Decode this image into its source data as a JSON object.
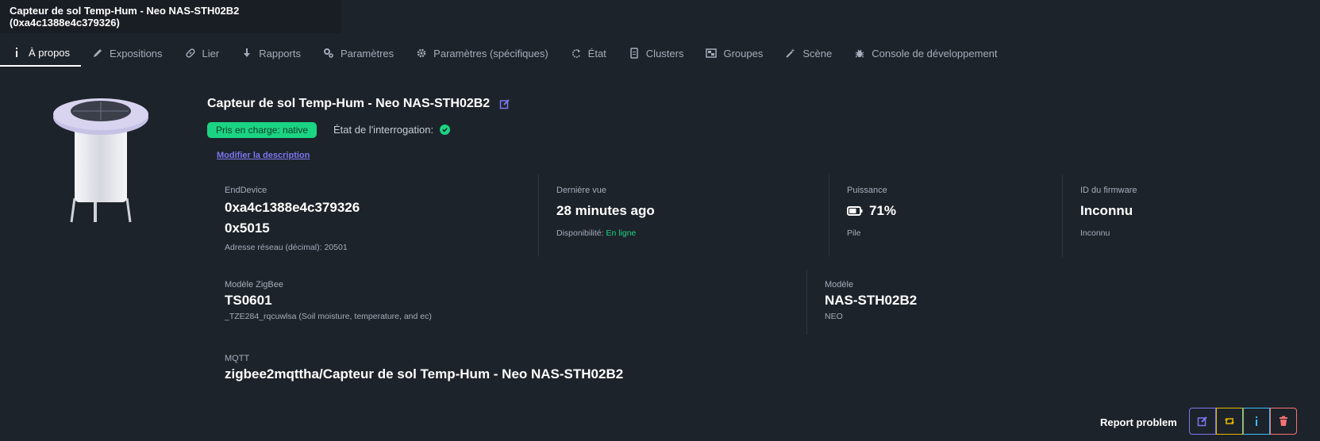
{
  "window_title": "Capteur de sol Temp-Hum - Neo NAS-STH02B2 (0xa4c1388e4c379326)",
  "tabs": [
    {
      "label": "À propos",
      "icon": "info-icon"
    },
    {
      "label": "Expositions",
      "icon": "pencil-icon"
    },
    {
      "label": "Lier",
      "icon": "link-icon"
    },
    {
      "label": "Rapports",
      "icon": "download-icon"
    },
    {
      "label": "Paramètres",
      "icon": "cogs-icon"
    },
    {
      "label": "Paramètres (spécifiques)",
      "icon": "gear-icon"
    },
    {
      "label": "État",
      "icon": "refresh-icon"
    },
    {
      "label": "Clusters",
      "icon": "file-icon"
    },
    {
      "label": "Groupes",
      "icon": "object-group-icon"
    },
    {
      "label": "Scène",
      "icon": "magic-wand-icon"
    },
    {
      "label": "Console de développement",
      "icon": "bug-icon"
    }
  ],
  "device": {
    "title": "Capteur de sol Temp-Hum - Neo NAS-STH02B2",
    "support_badge": "Pris en charge: native",
    "interrogation_label": "État de l'interrogation:",
    "edit_description": "Modifier la description"
  },
  "stats": {
    "enddevice": {
      "label": "EndDevice",
      "ieee": "0xa4c1388e4c379326",
      "nwk": "0x5015",
      "sub": "Adresse réseau (décimal): 20501"
    },
    "last_seen": {
      "label": "Dernière vue",
      "value": "28 minutes ago",
      "availability_label": "Disponibilité:",
      "availability_value": "En ligne"
    },
    "power": {
      "label": "Puissance",
      "value": "71%",
      "sub": "Pile",
      "battery_level": 0.71
    },
    "firmware": {
      "label": "ID du firmware",
      "value": "Inconnu",
      "sub": "Inconnu"
    },
    "zigbee_model": {
      "label": "Modèle ZigBee",
      "value": "TS0601",
      "sub": "_TZE284_rqcuwlsa (Soil moisture, temperature, and ec)"
    },
    "model": {
      "label": "Modèle",
      "value": "NAS-STH02B2",
      "sub": "NEO"
    },
    "mqtt": {
      "label": "MQTT",
      "value": "zigbee2mqttha/Capteur de sol Temp-Hum - Neo NAS-STH02B2"
    }
  },
  "footer": {
    "report_label": "Report problem"
  },
  "colors": {
    "accent": "#7b77f0",
    "success": "#1ad483",
    "warning": "#e6b800",
    "info": "#3abff8",
    "danger": "#f87272",
    "background": "#1d232a"
  }
}
